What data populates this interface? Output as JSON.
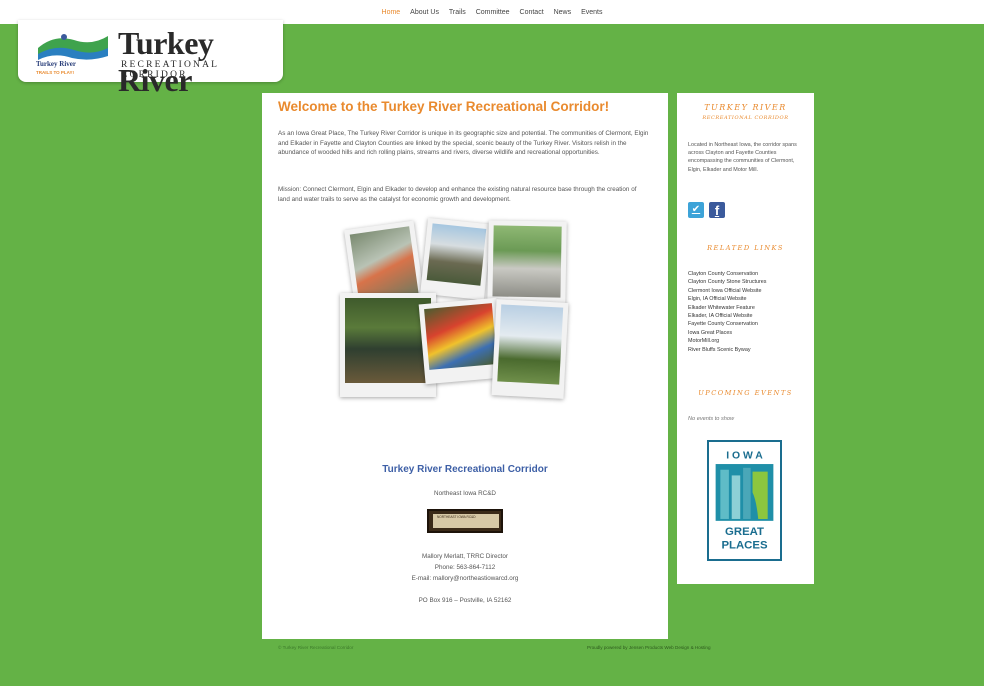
{
  "nav": {
    "items": [
      "Home",
      "About Us",
      "Trails",
      "Committee",
      "Contact",
      "News",
      "Events"
    ],
    "active": "Home"
  },
  "logo": {
    "title": "Turkey River",
    "subtitle": "RECREATIONAL CORRIDOR",
    "mark_title": "Turkey River",
    "mark_tag": "TRAILS TO PLAY!"
  },
  "main": {
    "heading": "Welcome to the Turkey River Recreational Corridor!",
    "paragraph1": "As an Iowa Great Place, The Turkey River Corridor is unique in its geographic size and potential. The communities of Clermont, Elgin and Elkader in Fayette and Clayton Counties are linked by the special, scenic beauty of the Turkey River. Visitors relish in the abundance of wooded hills and rich rolling plains, streams and rivers, diverse wildlife and recreational opportunities.",
    "paragraph2": "Mission: Connect Clermont, Elgin and Elkader to develop and enhance the existing natural resource base through the creation of land and water trails to serve as the catalyst for economic growth and development.",
    "contact_title": "Turkey River Recreational Corridor",
    "org": "Northeast Iowa RC&D",
    "org_logo_text": "NORTHEAST IOWA RC&D",
    "director": "Mallory Merlatt, TRRC Director",
    "phone": "Phone: 563-864-7112",
    "email": "E-mail: mallory@northeastiowarcd.org",
    "address": "PO Box 916 – Postville, IA 52162"
  },
  "sidebar": {
    "heading1": "TURKEY RIVER",
    "heading1b": "RECREATIONAL CORRIDOR",
    "intro": "Located in Northeast Iowa, the corridor spans across Clayton and Fayette Counties encompassing the communities of Clermont, Elgin, Elkader and Motor Mill.",
    "heading2": "RELATED LINKS",
    "links": [
      "Clayton County Conservation",
      "Clayton County Stone Structures",
      "Clermont Iowa Official Website",
      "Elgin, IA Official Website",
      "Elkader Whitewater Feature",
      "Elkader, IA Official Website",
      "Fayette County Conservation",
      "Iowa Great Places",
      "MotorMill.org",
      "River Bluffs Scenic Byway"
    ],
    "heading3": "UPCOMING EVENTS",
    "no_events": "No events to show",
    "iowa_top": "I O W A",
    "iowa_great": "GREAT",
    "iowa_places": "PLACES"
  },
  "footer": {
    "left": "© Turkey River Recreational Corridor",
    "right": "Proudly powered by Jensen Products Web Design & Hosting"
  },
  "colors": {
    "background": "#64b246",
    "accent_orange": "#e98a2e",
    "title_blue": "#3d5fa6"
  }
}
